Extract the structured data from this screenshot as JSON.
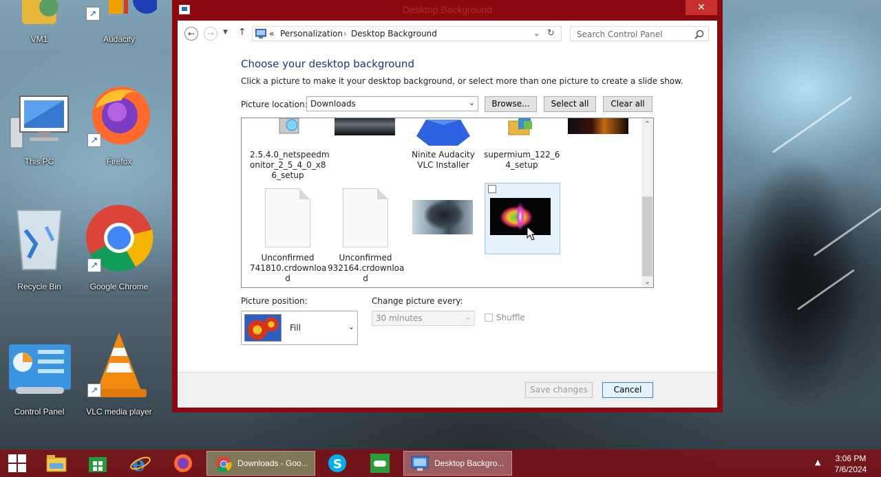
{
  "desktop": {
    "icons": [
      {
        "label": "VM1"
      },
      {
        "label": "Audacity"
      },
      {
        "label": "This PC"
      },
      {
        "label": "Firefox"
      },
      {
        "label": "Recycle Bin"
      },
      {
        "label": "Google Chrome"
      },
      {
        "label": "Control Panel"
      },
      {
        "label": "VLC media player"
      }
    ]
  },
  "window": {
    "title": "Desktop Background",
    "close_label": "✕",
    "address": {
      "chevrons": "«",
      "crumbs": [
        "Personalization",
        "Desktop Background"
      ],
      "separator": "›"
    },
    "search": {
      "placeholder": "Search Control Panel"
    },
    "heading": "Choose your desktop background",
    "subtext": "Click a picture to make it your desktop background, or select more than one picture to create a slide show.",
    "picture_location": {
      "label": "Picture location:",
      "value": "Downloads",
      "browse": "Browse...",
      "select_all": "Select all",
      "clear_all": "Clear all"
    },
    "pictures": [
      {
        "caption": "2.5.4.0_netspeedmonitor_2_5_4_0_x86_setup",
        "lines": [
          "2.5.4.0_netspeedm",
          "onitor_2_5_4_0_x8",
          "6_setup"
        ]
      },
      {
        "caption": "",
        "lines": []
      },
      {
        "caption": "Ninite Audacity VLC Installer",
        "lines": [
          "Ninite Audacity",
          "VLC Installer"
        ]
      },
      {
        "caption": "supermium_122_64_setup",
        "lines": [
          "supermium_122_6",
          "4_setup"
        ]
      },
      {
        "caption": "",
        "lines": []
      },
      {
        "caption": "Unconfirmed 741810.crdownload",
        "lines": [
          "Unconfirmed",
          "741810.crdownloa",
          "d"
        ]
      },
      {
        "caption": "Unconfirmed 932164.crdownload",
        "lines": [
          "Unconfirmed",
          "932164.crdownloa",
          "d"
        ]
      },
      {
        "caption": "",
        "lines": []
      },
      {
        "caption": "",
        "lines": [],
        "selected": true
      }
    ],
    "picture_position": {
      "label": "Picture position:",
      "value": "Fill"
    },
    "change_picture": {
      "label": "Change picture every:",
      "value": "30 minutes"
    },
    "shuffle": {
      "label": "Shuffle",
      "checked": false
    },
    "footer": {
      "save": "Save changes",
      "cancel": "Cancel"
    }
  },
  "taskbar": {
    "apps": [
      {
        "label": "Downloads - Goo...",
        "icon": "chrome-icon"
      },
      {
        "label": "Desktop Backgro...",
        "icon": "control-panel-icon"
      }
    ],
    "clock": {
      "time": "3:06 PM",
      "date": "7/6/2024"
    }
  },
  "colors": {
    "window_frame": "#8b0a10",
    "heading": "#1e3287",
    "close_button": "#c7302b",
    "taskbar": "#781418"
  }
}
